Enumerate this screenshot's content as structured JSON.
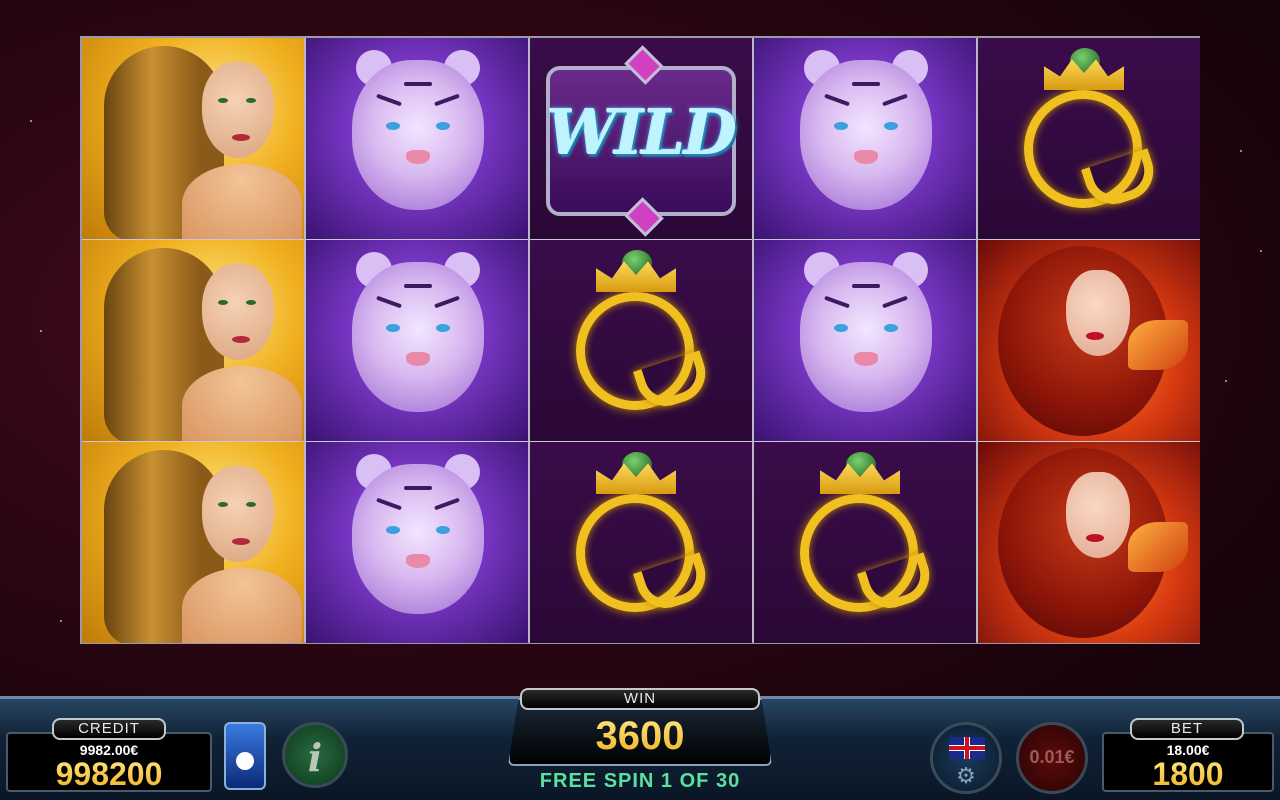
{
  "reels": [
    [
      "blonde-woman",
      "blonde-woman",
      "blonde-woman"
    ],
    [
      "white-tiger",
      "white-tiger",
      "white-tiger"
    ],
    [
      "wild",
      "queen",
      "queen"
    ],
    [
      "white-tiger",
      "white-tiger",
      "queen"
    ],
    [
      "queen",
      "red-haired-woman",
      "red-haired-woman"
    ]
  ],
  "wild_label": "WILD",
  "credit": {
    "label": "CREDIT",
    "currency": "9982.00€",
    "amount": "998200"
  },
  "win": {
    "label": "WIN",
    "amount": "3600"
  },
  "free_spins": "FREE SPIN 1 OF 30",
  "denomination": "0.01€",
  "bet": {
    "label": "BET",
    "currency": "18.00€",
    "amount": "1800"
  },
  "info_glyph": "i",
  "icons": {
    "language": "uk-flag-icon",
    "settings": "gear-icon",
    "info": "info-icon",
    "autoplay": "autoplay-icon"
  },
  "colors": {
    "gold": "#f0c020",
    "accent_green": "#5ae0a0",
    "frame": "#9a9aa8"
  }
}
